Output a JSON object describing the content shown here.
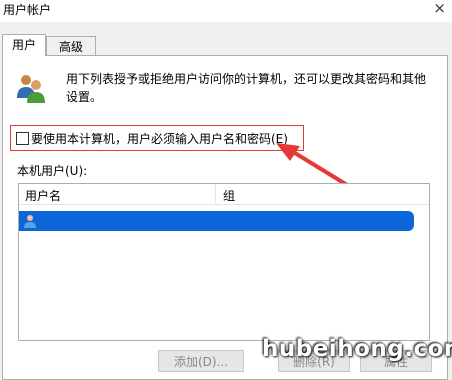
{
  "window": {
    "title": "用户帐户",
    "close_glyph": "×"
  },
  "tabs": [
    {
      "label": "用户"
    },
    {
      "label": "高级"
    }
  ],
  "description": "用下列表授予或拒绝用户访问你的计算机，还可以更改其密码和其他设置。",
  "checkbox": {
    "label": "要使用本计算机，用户必须输入用户名和密码(E)",
    "checked": false
  },
  "local_users": {
    "label": "本机用户(U):",
    "columns": [
      "用户名",
      "组"
    ],
    "rows": [
      {
        "selected": true
      }
    ]
  },
  "buttons": {
    "add": "添加(D)...",
    "delete": "删除(R)",
    "properties": "属性"
  },
  "watermark": "hubeihong.com",
  "colors": {
    "highlight_box": "#e53935",
    "arrow": "#e53935",
    "selection": "#0c66d9"
  }
}
